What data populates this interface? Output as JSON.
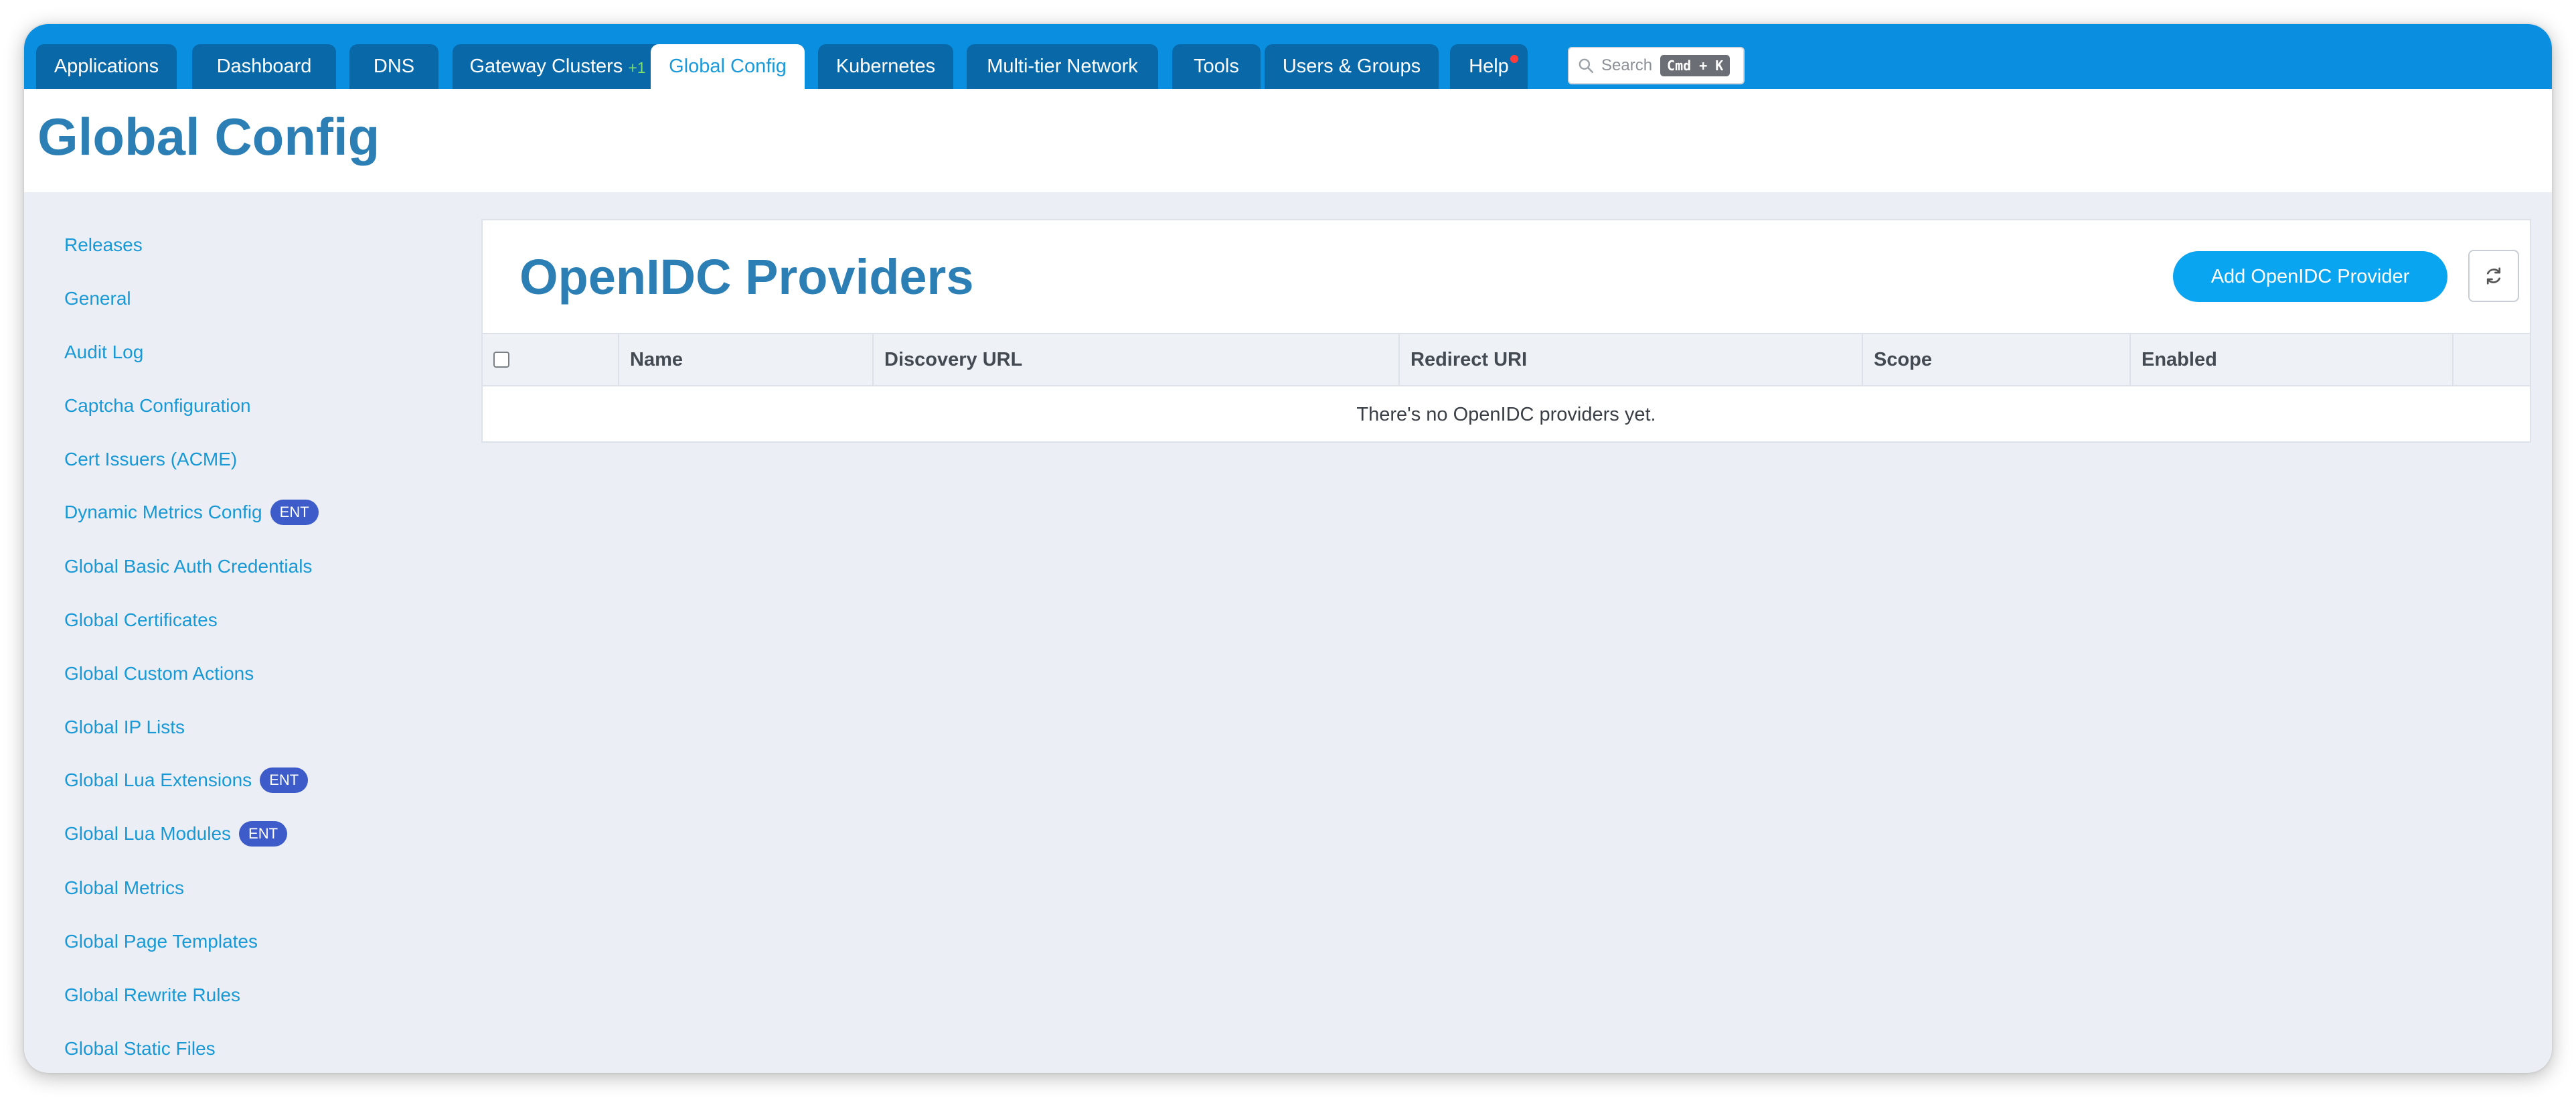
{
  "nav": {
    "tabs": [
      {
        "label": "Applications"
      },
      {
        "label": "Dashboard"
      },
      {
        "label": "DNS"
      },
      {
        "label": "Gateway Clusters",
        "badge": "+1"
      },
      {
        "label": "Global Config",
        "active": true
      },
      {
        "label": "Kubernetes"
      },
      {
        "label": "Multi-tier Network"
      },
      {
        "label": "Tools"
      },
      {
        "label": "Users & Groups"
      },
      {
        "label": "Help",
        "notification": true
      }
    ],
    "search": {
      "placeholder": "Search",
      "shortcut": "Cmd + K"
    }
  },
  "page": {
    "title": "Global Config"
  },
  "sidebar": {
    "items": [
      {
        "label": "Releases"
      },
      {
        "label": "General"
      },
      {
        "label": "Audit Log"
      },
      {
        "label": "Captcha Configuration"
      },
      {
        "label": "Cert Issuers (ACME)"
      },
      {
        "label": "Dynamic Metrics Config",
        "badge": "ENT"
      },
      {
        "label": "Global Basic Auth Credentials"
      },
      {
        "label": "Global Certificates"
      },
      {
        "label": "Global Custom Actions"
      },
      {
        "label": "Global IP Lists"
      },
      {
        "label": "Global Lua Extensions",
        "badge": "ENT"
      },
      {
        "label": "Global Lua Modules",
        "badge": "ENT"
      },
      {
        "label": "Global Metrics"
      },
      {
        "label": "Global Page Templates"
      },
      {
        "label": "Global Rewrite Rules"
      },
      {
        "label": "Global Static Files"
      }
    ]
  },
  "panel": {
    "title": "OpenIDC Providers",
    "add_button": "Add OpenIDC Provider",
    "refresh_icon": "refresh-icon",
    "columns": [
      "Name",
      "Discovery URL",
      "Redirect URI",
      "Scope",
      "Enabled"
    ],
    "empty_message": "There's no OpenIDC providers yet."
  },
  "colors": {
    "nav_bg": "#0a8fe0",
    "tab_bg": "#0868a8",
    "accent": "#2c7fb5",
    "link": "#1899d6",
    "button": "#0aa5f0",
    "badge": "#3d5cc9"
  }
}
